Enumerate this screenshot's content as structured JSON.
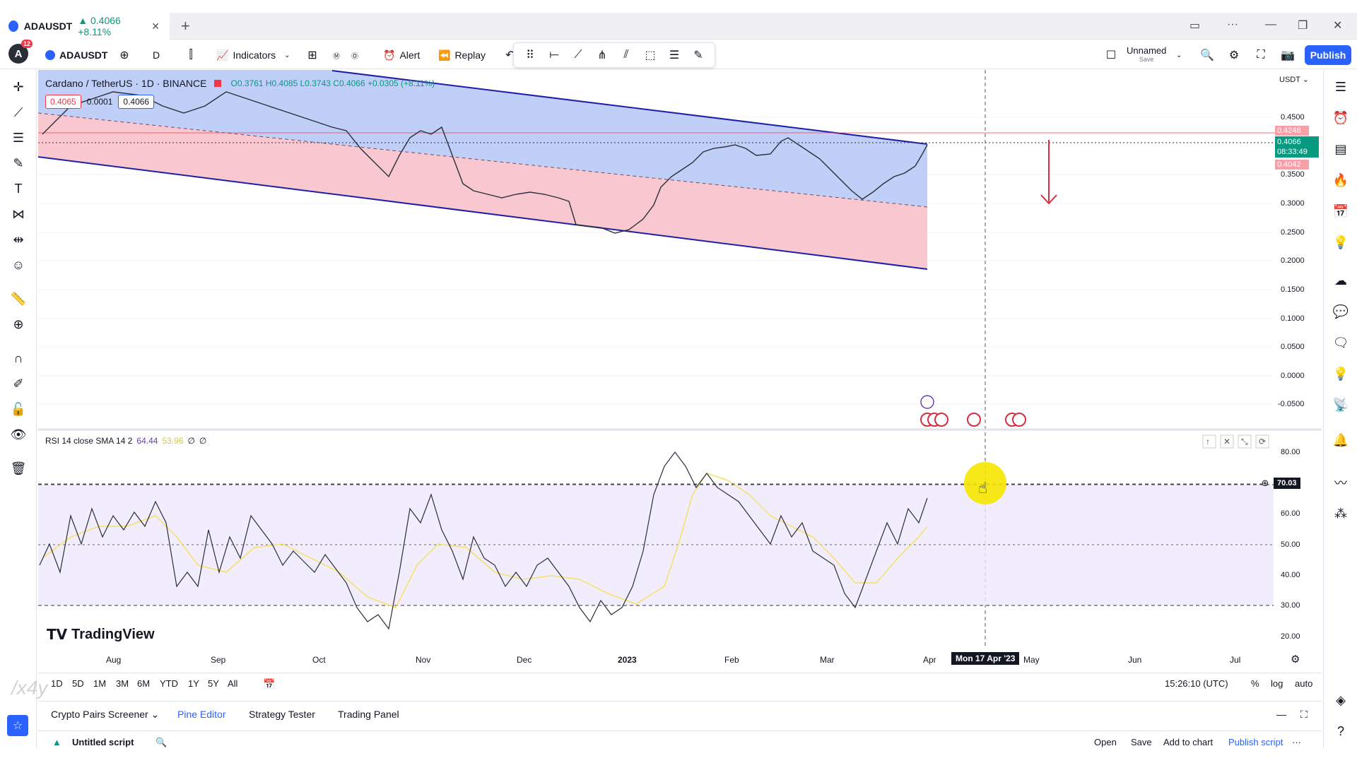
{
  "browser_tab": {
    "symbol": "ADAUSDT",
    "change": "▲ 0.4066 +8.11%",
    "close": "✕",
    "new_tab": "+"
  },
  "toolbar": {
    "avatar": "A",
    "avatar_badge": "12",
    "symbol": "ADAUSDT",
    "interval": "D",
    "indicators": "Indicators",
    "alert": "Alert",
    "replay": "Replay",
    "layout_name": "Unnamed",
    "layout_save": "Save",
    "publish": "Publish"
  },
  "chart_header": {
    "title": "Cardano / TetherUS · 1D · BINANCE",
    "ohlc": "O0.3761 H0.4085 L0.3743 C0.4066 +0.0305 (+8.11%)",
    "bid": "0.4065",
    "spread": "0.0001",
    "ask": "0.4066"
  },
  "price_axis": {
    "currency": "USDT",
    "ticks": [
      "0.4500",
      "0.3500",
      "0.3000",
      "0.2500",
      "0.2000",
      "0.1500",
      "0.1000",
      "0.0500",
      "0.0000",
      "-0.0500"
    ],
    "label_top": "0.4248",
    "label_last": "0.4066",
    "label_countdown": "08:33:49",
    "label_low": "0.4042"
  },
  "rsi": {
    "legend": "RSI 14 close SMA 14 2",
    "value1": "64.44",
    "value2": "53.96",
    "value3": "∅",
    "value4": "∅",
    "ticks": [
      "80.00",
      "60.00",
      "50.00",
      "40.00",
      "30.00",
      "20.00"
    ],
    "crosshair_value": "70.03"
  },
  "time_axis": {
    "ticks": [
      "Aug",
      "Sep",
      "Oct",
      "Nov",
      "Dec",
      "2023",
      "Feb",
      "Mar",
      "Apr",
      "May",
      "Jun",
      "Jul"
    ],
    "crosshair_label": "Mon 17 Apr '23"
  },
  "branding": "TradingView",
  "timeframes": [
    "1D",
    "5D",
    "1M",
    "3M",
    "6M",
    "YTD",
    "1Y",
    "5Y",
    "All"
  ],
  "status": {
    "clock": "15:26:10 (UTC)",
    "percent": "%",
    "log": "log",
    "auto": "auto"
  },
  "panels": {
    "screener": "Crypto Pairs Screener",
    "pine": "Pine Editor",
    "strategy": "Strategy Tester",
    "trading": "Trading Panel"
  },
  "script": {
    "name": "Untitled script",
    "open": "Open",
    "save": "Save",
    "add": "Add to chart",
    "publish": "Publish script"
  },
  "watermark": "/x4y",
  "colors": {
    "accent": "#2962ff",
    "up": "#089981",
    "down": "#f23645",
    "channel_blue": "#1e1ea8"
  }
}
